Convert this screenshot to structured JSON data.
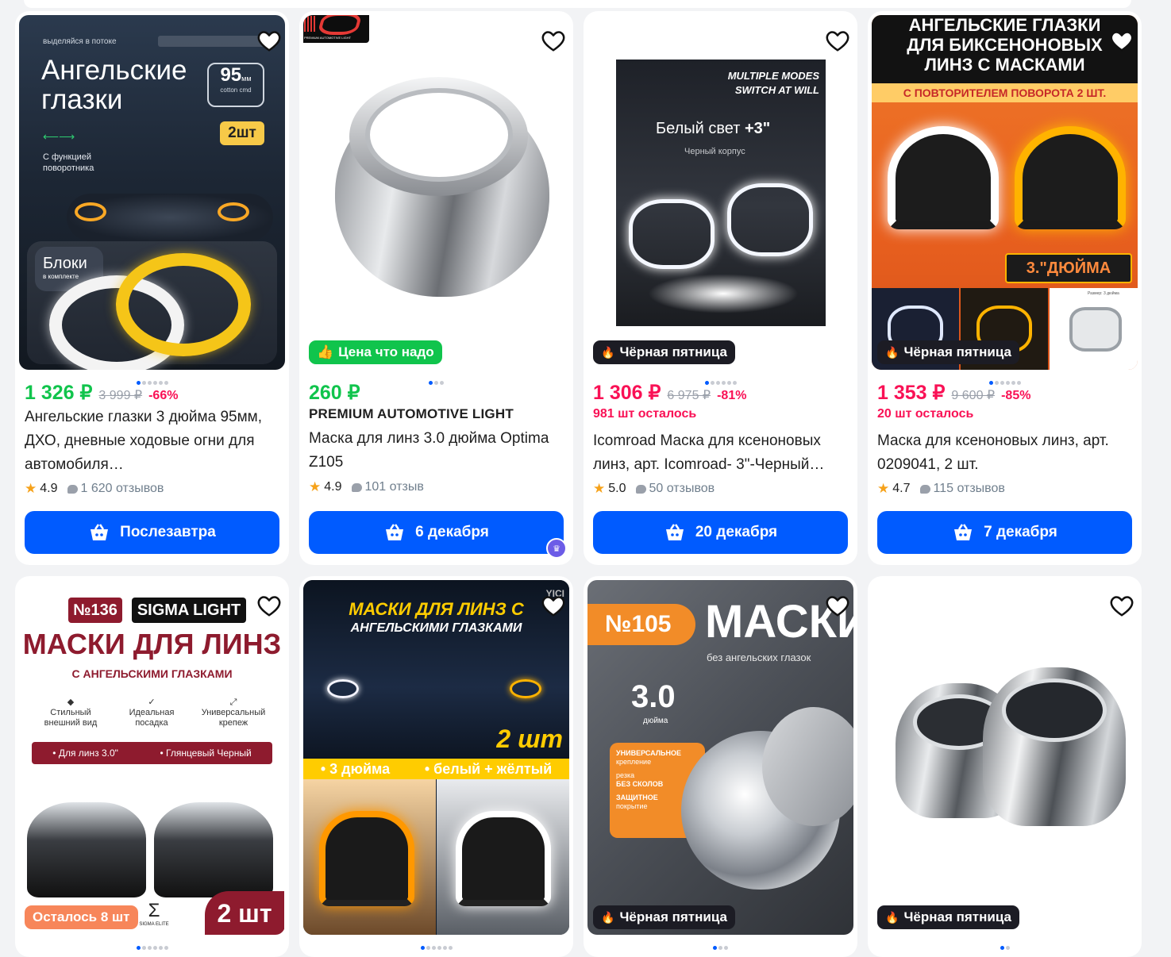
{
  "products": [
    {
      "price": "1 326 ₽",
      "old_price": "3 999 ₽",
      "discount": "-66%",
      "title": "Ангельские глазки 3 дюйма 95мм, ДХО, дневные ходовые огни для автомобиля…",
      "rating": "4.9",
      "reviews": "1 620 отзывов",
      "delivery": "Послезавтра",
      "image": {
        "t1": "выделяйся в потоке",
        "h1": "Ангельские",
        "h2": "глазки",
        "size": "95",
        "unit": "мм",
        "sub": "cotton cmd",
        "qty": "2шт",
        "func1": "С функцией",
        "func2": "поворотника",
        "blocks": "Блоки",
        "blocks_sub": "в комплекте"
      }
    },
    {
      "price": "260 ₽",
      "badge": "Цена что надо",
      "brand": "PREMIUM AUTOMOTIVE LIGHT",
      "title": "Маска для линз 3.0 дюйма Optima Z105",
      "rating": "4.9",
      "reviews": "101 отзыв",
      "delivery": "6 декабря",
      "image": {
        "logo_sub": "PREMIUM AUTOMOTIVE LIGHT"
      }
    },
    {
      "price": "1 306 ₽",
      "old_price": "6 975 ₽",
      "discount": "-81%",
      "stock": "981 шт осталось",
      "badge": "Чёрная пятница",
      "title": "Icomroad Маска для ксеноновых линз, арт. Icomroad- 3\"-Черный…",
      "rating": "5.0",
      "reviews": "50 отзывов",
      "delivery": "20 декабря",
      "image": {
        "m1": "MULTIPLE MODES",
        "m2": "SWITCH AT WILL",
        "white": "Белый свет",
        "plus": "+3\"",
        "body": "Черный корпус"
      }
    },
    {
      "price": "1 353 ₽",
      "old_price": "9 600 ₽",
      "discount": "-85%",
      "stock": "20 шт осталось",
      "badge": "Чёрная пятница",
      "title": "Маска для ксеноновых линз, арт. 0209041, 2 шт.",
      "rating": "4.7",
      "reviews": "115 отзывов",
      "delivery": "7 декабря",
      "image": {
        "l1": "АНГЕЛЬСКИЕ ГЛАЗКИ",
        "l2": "ДЛЯ БИКСЕНОНОВЫХ",
        "l3": "ЛИНЗ С МАСКАМИ",
        "l4": "С ПОВТОРИТЕЛЕМ ПОВОРОТА 2 ШТ.",
        "inch": "3.\"ДЮЙМА",
        "size_label": "Размер: 3 дюйма"
      }
    },
    {
      "badge": "Осталось 8 шт",
      "image": {
        "num": "№136",
        "brand": "SIGMA LIGHT",
        "h": "МАСКИ ДЛЯ ЛИНЗ",
        "sub": "С АНГЕЛЬСКИМИ ГЛАЗКАМИ",
        "f1a": "Стильный",
        "f1b": "внешний вид",
        "f2a": "Идеальная",
        "f2b": "посадка",
        "f3a": "Универсальный",
        "f3b": "крепеж",
        "b1": "• Для линз 3.0\"",
        "b2": "• Глянцевый Черный",
        "qty": "2 шт",
        "logo": "SIGMA ELITE"
      }
    },
    {
      "image": {
        "h1": "МАСКИ ДЛЯ ЛИНЗ С",
        "h2": "АНГЕЛЬСКИМИ ГЛАЗКАМИ",
        "qty": "2 шт",
        "s1": "• 3 дюйма",
        "s2": "• белый + жёлтый",
        "corner": "YICI"
      }
    },
    {
      "badge": "Чёрная пятница",
      "image": {
        "num": "№105",
        "h": "МАСКИ",
        "sub": "без ангельских глазок",
        "size": "3.0",
        "unit": "дюйма",
        "p1": "УНИВЕРСАЛЬНОЕ",
        "p1b": "крепление",
        "p2": "резка",
        "p2b": "БЕЗ СКОЛОВ",
        "p3": "ЗАЩИТНОЕ",
        "p3b": "покрытие"
      }
    },
    {
      "badge": "Чёрная пятница"
    }
  ],
  "colors": {
    "accent": "#005bff",
    "green": "#10c44c",
    "pink": "#f91155",
    "dark": "#1c1c24"
  }
}
